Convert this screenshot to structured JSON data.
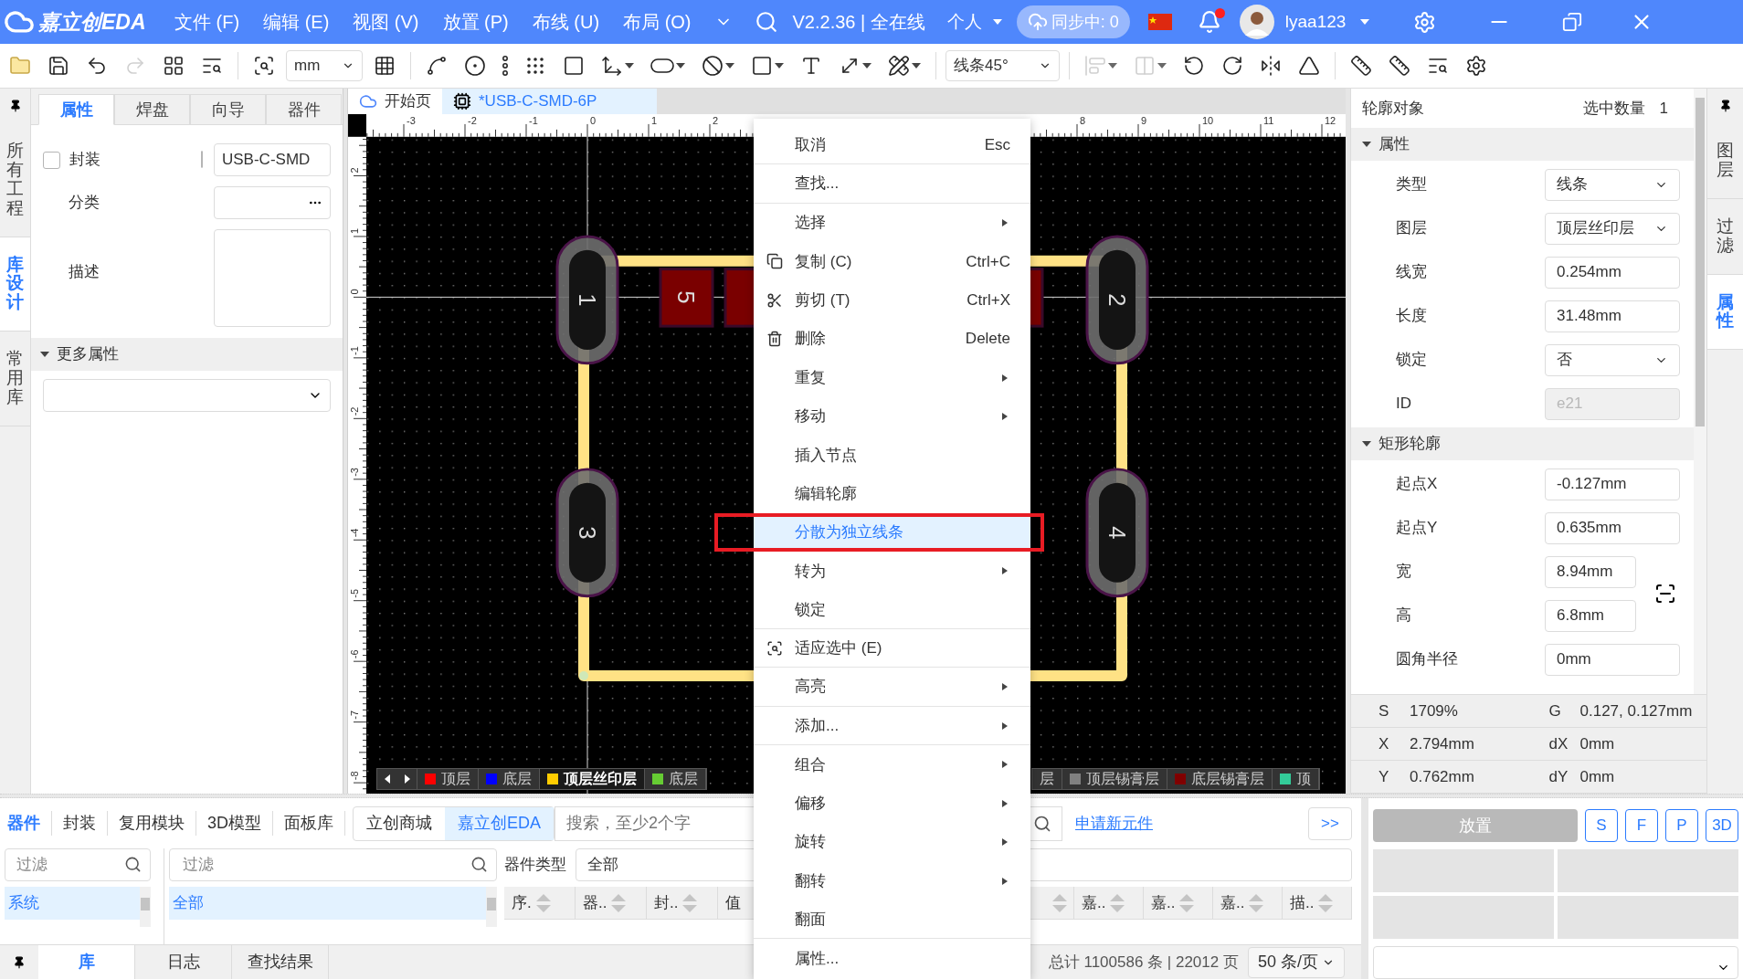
{
  "title_bar": {
    "logo": "嘉立创EDA",
    "menus": [
      "文件 (F)",
      "编辑 (E)",
      "视图 (V)",
      "放置 (P)",
      "布线 (U)",
      "布局 (O)"
    ],
    "version": "V2.2.36 | 全在线",
    "account_type": "个人",
    "sync": "同步中: 0",
    "notification": true,
    "user": "lyaa123"
  },
  "toolbar": {
    "unit": "mm",
    "route_mode": "线条45°",
    "groups": [
      {
        "items": [
          {
            "kind": "open",
            "disabled": false
          },
          {
            "kind": "save",
            "disabled": false
          },
          {
            "kind": "undo",
            "disabled": false
          },
          {
            "kind": "redo",
            "disabled": true
          },
          {
            "kind": "tiles",
            "disabled": false
          },
          {
            "kind": "list",
            "disabled": false
          }
        ]
      },
      {
        "items": [
          {
            "kind": "box_select",
            "disabled": false
          },
          {
            "kind": "unit",
            "disabled": false
          },
          {
            "kind": "grid",
            "disabled": false
          }
        ]
      },
      {
        "items": [
          {
            "kind": "pin",
            "disabled": false
          },
          {
            "kind": "ring",
            "disabled": false
          },
          {
            "kind": "dots_column",
            "disabled": false
          },
          {
            "kind": "dots_grid",
            "disabled": false
          },
          {
            "kind": "round_rect",
            "disabled": false
          },
          {
            "kind": "step",
            "disabled": false
          },
          {
            "kind": "oval",
            "disabled": false
          },
          {
            "kind": "no_entry",
            "disabled": false
          },
          {
            "kind": "square",
            "disabled": false
          },
          {
            "kind": "text",
            "disabled": false
          },
          {
            "kind": "dimension",
            "disabled": false
          },
          {
            "kind": "axis",
            "disabled": false
          }
        ]
      },
      {
        "items": [
          {
            "kind": "route",
            "disabled": false
          }
        ]
      },
      {
        "items": [
          {
            "kind": "align",
            "disabled": true
          },
          {
            "kind": "distribute",
            "disabled": true
          },
          {
            "kind": "rotate_left",
            "disabled": false
          },
          {
            "kind": "rotate_right",
            "disabled": false
          },
          {
            "kind": "flip",
            "disabled": false
          },
          {
            "kind": "mirror",
            "disabled": false
          }
        ]
      },
      {
        "items": [
          {
            "kind": "ruler",
            "disabled": false
          },
          {
            "kind": "measure",
            "disabled": false
          },
          {
            "kind": "ruler_search",
            "disabled": false
          },
          {
            "kind": "settings",
            "disabled": false
          }
        ]
      }
    ]
  },
  "left_rail": [
    {
      "label": "所有工程",
      "selected": false
    },
    {
      "label": "库设计",
      "selected": true
    },
    {
      "label": "常用库",
      "selected": false
    }
  ],
  "left_panel": {
    "tabs": [
      {
        "label": "属性",
        "selected": true
      },
      {
        "label": "焊盘",
        "selected": false
      },
      {
        "label": "向导",
        "selected": false
      },
      {
        "label": "器件",
        "selected": false
      }
    ],
    "package": {
      "label": "封装",
      "checked": false
    },
    "package_name": {
      "checked": false,
      "value": "USB-C-SMD"
    },
    "category_label": "分类",
    "description_label": "描述",
    "more": {
      "label": "更多属性",
      "expanded": true
    }
  },
  "doc_tabs": [
    {
      "label": "开始页",
      "kind": "home",
      "selected": false
    },
    {
      "label": "*USB-C-SMD-6P",
      "kind": "footprint",
      "selected": true
    }
  ],
  "canvas": {
    "top_ruler": [
      "-3",
      "-2",
      "-1",
      "0",
      "1",
      "2",
      "8",
      "9",
      "10",
      "11",
      "12"
    ],
    "left_ruler": [
      "2",
      "1",
      "0",
      "-1",
      "-2",
      "-3",
      "-4",
      "-5",
      "-6",
      "-7",
      "-8"
    ],
    "pads": [
      {
        "label": "1",
        "kind": "oval"
      },
      {
        "label": "2",
        "kind": "oval"
      },
      {
        "label": "3",
        "kind": "oval"
      },
      {
        "label": "4",
        "kind": "oval"
      },
      {
        "label": "5",
        "kind": "smd"
      }
    ],
    "layers_left": [
      {
        "label": "顶层",
        "color": "#ff0000",
        "selected": false
      },
      {
        "label": "底层",
        "color": "#0000ff",
        "selected": false
      },
      {
        "label": "顶层丝印层",
        "color": "#ffcc00",
        "selected": true
      },
      {
        "label": "底层",
        "color": "#66cc33",
        "selected": false
      }
    ],
    "layers_right": [
      {
        "label": "层",
        "selected": false
      },
      {
        "label": "顶层锡膏层",
        "color": "#808080",
        "selected": false
      },
      {
        "label": "底层锡膏层",
        "color": "#800000",
        "selected": false
      },
      {
        "label": "顶",
        "color": "#33cc99",
        "selected": false
      }
    ]
  },
  "context_menu": [
    {
      "label": "取消",
      "shortcut": "Esc",
      "separator": true,
      "submenu": false,
      "selected": false,
      "boxed": false
    },
    {
      "label": "查找...",
      "separator": true,
      "submenu": false,
      "selected": false,
      "boxed": false
    },
    {
      "label": "选择",
      "separator": false,
      "submenu": true,
      "selected": false,
      "boxed": false
    },
    {
      "label": "复制 (C)",
      "shortcut": "Ctrl+C",
      "kind": "copy",
      "separator": false,
      "submenu": false,
      "selected": false,
      "boxed": false
    },
    {
      "label": "剪切 (T)",
      "shortcut": "Ctrl+X",
      "kind": "cut",
      "separator": false,
      "submenu": false,
      "selected": false,
      "boxed": false
    },
    {
      "label": "删除",
      "shortcut": "Delete",
      "kind": "delete",
      "separator": false,
      "submenu": false,
      "selected": false,
      "boxed": false
    },
    {
      "label": "重复",
      "separator": false,
      "submenu": true,
      "selected": false,
      "boxed": false
    },
    {
      "label": "移动",
      "separator": false,
      "submenu": true,
      "selected": false,
      "boxed": false
    },
    {
      "label": "插入节点",
      "separator": false,
      "submenu": false,
      "selected": false,
      "boxed": false
    },
    {
      "label": "编辑轮廓",
      "separator": false,
      "submenu": false,
      "selected": false,
      "boxed": false
    },
    {
      "label": "分散为独立线条",
      "separator": false,
      "submenu": false,
      "selected": true,
      "boxed": true
    },
    {
      "label": "转为",
      "separator": false,
      "submenu": true,
      "selected": false,
      "boxed": false
    },
    {
      "label": "锁定",
      "separator": true,
      "submenu": false,
      "selected": false,
      "boxed": false
    },
    {
      "label": "适应选中 (E)",
      "kind": "fit",
      "separator": true,
      "submenu": false,
      "selected": false,
      "boxed": false
    },
    {
      "label": "高亮",
      "separator": true,
      "submenu": true,
      "selected": false,
      "boxed": false
    },
    {
      "label": "添加...",
      "separator": true,
      "submenu": true,
      "selected": false,
      "boxed": false
    },
    {
      "label": "组合",
      "separator": false,
      "submenu": true,
      "selected": false,
      "boxed": false
    },
    {
      "label": "偏移",
      "separator": false,
      "submenu": true,
      "selected": false,
      "boxed": false
    },
    {
      "label": "旋转",
      "separator": false,
      "submenu": true,
      "selected": false,
      "boxed": false
    },
    {
      "label": "翻转",
      "separator": false,
      "submenu": true,
      "selected": false,
      "boxed": false
    },
    {
      "label": "翻面",
      "separator": true,
      "submenu": false,
      "selected": false,
      "boxed": false
    },
    {
      "label": "属性...",
      "separator": false,
      "submenu": false,
      "selected": false,
      "boxed": false
    }
  ],
  "right_panel": {
    "title": "轮廓对象",
    "count_label": "选中数量",
    "count": "1",
    "sections": [
      {
        "title": "属性",
        "expanded": true,
        "rows": [
          {
            "label": "类型",
            "value": "线条",
            "kind": "select",
            "disabled": false
          },
          {
            "label": "图层",
            "value": "顶层丝印层",
            "kind": "select",
            "disabled": false
          },
          {
            "label": "线宽",
            "value": "0.254mm",
            "kind": "text",
            "disabled": false
          },
          {
            "label": "长度",
            "value": "31.48mm",
            "kind": "text",
            "disabled": false
          },
          {
            "label": "锁定",
            "value": "否",
            "kind": "select",
            "disabled": false
          },
          {
            "label": "ID",
            "value": "e21",
            "kind": "text",
            "disabled": true
          }
        ]
      },
      {
        "title": "矩形轮廓",
        "expanded": true,
        "rows": [
          {
            "label": "起点X",
            "value": "-0.127mm",
            "kind": "text",
            "disabled": false
          },
          {
            "label": "起点Y",
            "value": "0.635mm",
            "kind": "text",
            "disabled": false
          },
          {
            "label": "宽",
            "value": "8.94mm",
            "kind": "short",
            "disabled": false
          },
          {
            "label": "高",
            "value": "6.8mm",
            "kind": "short",
            "disabled": false
          },
          {
            "label": "圆角半径",
            "value": "0mm",
            "kind": "text",
            "disabled": false
          }
        ]
      }
    ],
    "status": [
      {
        "label": "S",
        "value": "1709%"
      },
      {
        "label": "G",
        "value": "0.127, 0.127mm"
      },
      {
        "label": "X",
        "value": "2.794mm"
      },
      {
        "label": "dX",
        "value": "0mm"
      },
      {
        "label": "Y",
        "value": "0.762mm"
      },
      {
        "label": "dY",
        "value": "0mm"
      }
    ]
  },
  "right_rail": [
    {
      "label": "图层",
      "selected": false
    },
    {
      "label": "过滤",
      "selected": false
    },
    {
      "label": "属性",
      "selected": true
    }
  ],
  "library": {
    "tabs": [
      {
        "label": "器件",
        "selected": true
      },
      {
        "label": "封装",
        "selected": false
      },
      {
        "label": "复用模块",
        "selected": false
      },
      {
        "label": "3D模型",
        "selected": false
      },
      {
        "label": "面板库",
        "selected": false
      }
    ],
    "sources": [
      {
        "label": "立创商城",
        "selected": false
      },
      {
        "label": "嘉立创EDA",
        "selected": true
      }
    ],
    "search": {
      "placeholder": "搜索，至少2个字"
    },
    "request_link": "申请新元件",
    "expand": ">>",
    "category_filter": {
      "placeholder": "过滤"
    },
    "group_filter": {
      "placeholder": "过滤"
    },
    "type_label": "器件类型",
    "type_value": "全部",
    "categories": [
      {
        "label": "系统",
        "selected": true
      }
    ],
    "groups": [
      {
        "label": "全部",
        "selected": true
      }
    ],
    "columns_left": [
      "序.",
      "器..",
      "封..",
      "值"
    ],
    "columns_right": [
      "嘉..",
      "嘉..",
      "嘉..",
      "描.."
    ],
    "total": "总计 1100586 条 | 22012 页",
    "page_size": "50 条/页"
  },
  "preview": {
    "place": "放置",
    "place_disabled": true,
    "views": [
      "S",
      "F",
      "P",
      "3D"
    ]
  },
  "bottom_tabs": [
    {
      "label": "库",
      "selected": true
    },
    {
      "label": "日志",
      "selected": false
    },
    {
      "label": "查找结果",
      "selected": false
    }
  ]
}
